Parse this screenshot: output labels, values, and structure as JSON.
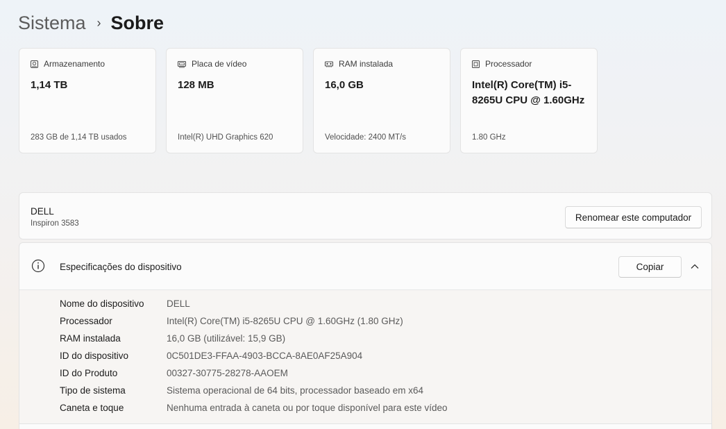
{
  "breadcrumb": {
    "parent": "Sistema",
    "separator": "›",
    "current": "Sobre"
  },
  "cards": [
    {
      "icon": "storage-icon",
      "title": "Armazenamento",
      "value": "1,14 TB",
      "footer": "283 GB de 1,14 TB usados"
    },
    {
      "icon": "gpu-icon",
      "title": "Placa de vídeo",
      "value": "128 MB",
      "footer": "Intel(R) UHD Graphics 620"
    },
    {
      "icon": "ram-icon",
      "title": "RAM instalada",
      "value": "16,0 GB",
      "footer": "Velocidade: 2400 MT/s"
    },
    {
      "icon": "processor-icon",
      "title": "Processador",
      "value": "Intel(R) Core(TM) i5-8265U CPU @ 1.60GHz",
      "footer": "1.80 GHz"
    }
  ],
  "device": {
    "name": "DELL",
    "model": "Inspiron 3583",
    "rename_label": "Renomear este computador"
  },
  "specs": {
    "title": "Especificações do dispositivo",
    "copy_label": "Copiar",
    "rows": [
      {
        "label": "Nome do dispositivo",
        "value": "DELL"
      },
      {
        "label": "Processador",
        "value": "Intel(R) Core(TM) i5-8265U CPU @ 1.60GHz (1.80 GHz)"
      },
      {
        "label": "RAM instalada",
        "value": "16,0 GB (utilizável: 15,9 GB)"
      },
      {
        "label": "ID do dispositivo",
        "value": "0C501DE3-FFAA-4903-BCCA-8AE0AF25A904"
      },
      {
        "label": "ID do Produto",
        "value": "00327-30775-28278-AAOEM"
      },
      {
        "label": "Tipo de sistema",
        "value": "Sistema operacional de 64 bits, processador baseado em x64"
      },
      {
        "label": "Caneta e toque",
        "value": "Nenhuma entrada à caneta ou por toque disponível para este vídeo"
      }
    ]
  }
}
